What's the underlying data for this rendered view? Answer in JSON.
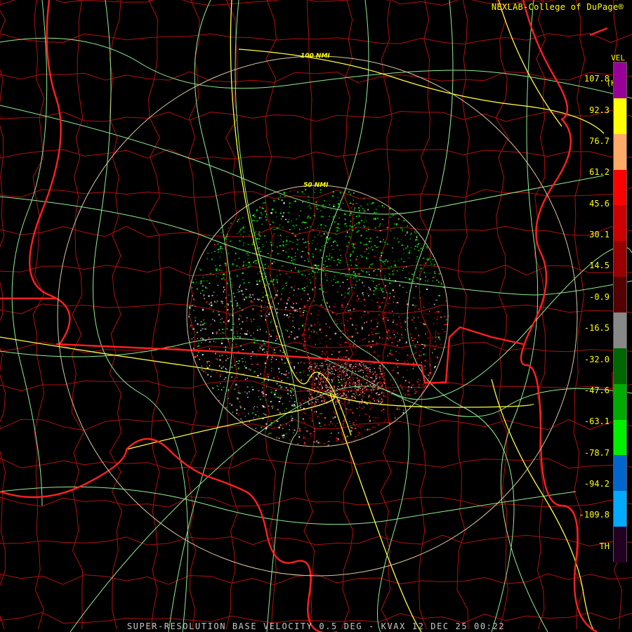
{
  "header": {
    "credit": "NEXLAB-College of DuPage®",
    "product": "VEL",
    "units": "(KT)"
  },
  "colorbar": {
    "ticks": [
      "107.8",
      "92.3",
      "76.7",
      "61.2",
      "45.6",
      "30.1",
      "14.5",
      "-0.9",
      "-16.5",
      "-32.0",
      "-47.6",
      "-63.1",
      "-78.7",
      "-94.2",
      "-109.8",
      "TH"
    ],
    "segments": [
      {
        "color": "#990099"
      },
      {
        "color": "#ffff00"
      },
      {
        "color": "#ffaa66"
      },
      {
        "color": "#ff0000"
      },
      {
        "color": "#cc0000"
      },
      {
        "color": "#990000"
      },
      {
        "color": "#550000"
      },
      {
        "color": "#888888"
      },
      {
        "color": "#006600"
      },
      {
        "color": "#00aa00"
      },
      {
        "color": "#00ee00"
      },
      {
        "color": "#0066cc"
      },
      {
        "color": "#00aaff"
      },
      {
        "color": "#220022"
      }
    ]
  },
  "range_rings": [
    "100 NMI",
    "50 NMI"
  ],
  "caption": "SUPER-RESOLUTION BASE VELOCITY 0.5 DEG - KVAX 12 DEC 25 00:22",
  "map_colors": {
    "state_border": "#ff2020",
    "county_line": "#b01010",
    "highway": "#ffff40",
    "road": "#90ee90",
    "range_ring": "#d8c8a0"
  }
}
